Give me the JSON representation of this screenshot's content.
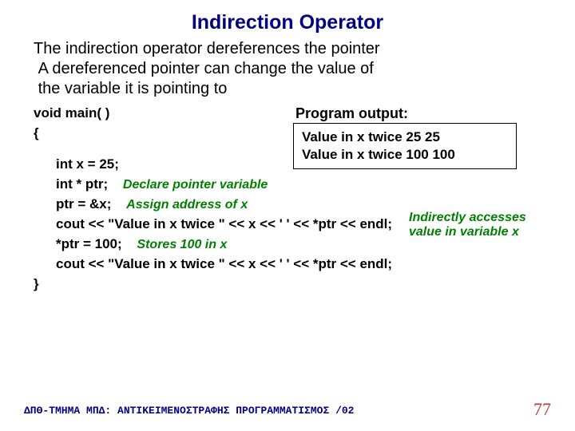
{
  "title": "Indirection Operator",
  "body": {
    "line1": "The indirection operator dereferences the pointer",
    "line2": "A dereferenced pointer can change the value of",
    "line3": "the variable it is pointing to"
  },
  "code": {
    "l1": "void main( )",
    "l2": "{",
    "l3": "int x = 25;",
    "l4": "int * ptr;",
    "l4_comment": "Declare pointer variable",
    "l5": "ptr = &x;",
    "l5_comment": "Assign address of x",
    "l6": "cout << \"Value in x twice \" << x << ' ' << *ptr << endl;",
    "l7": "*ptr = 100;",
    "l7_comment": "Stores 100 in x",
    "l8": "cout << \"Value in x twice \" << x << ' ' << *ptr << endl;",
    "l9": "}"
  },
  "output": {
    "label": "Program output:",
    "line1": "Value in x twice 25 25",
    "line2": "Value in x twice 100 100"
  },
  "side_note": {
    "line1": "Indirectly accesses",
    "line2": "value in variable x"
  },
  "footer": {
    "left": "ΔΠΘ-ΤΜΗΜΑ ΜΠΔ: ΑΝΤΙΚΕΙΜΕΝΟΣΤΡΑΦΗΣ ΠΡΟΓΡΑΜΜΑΤΙΣΜΟΣ /02",
    "right": "77"
  }
}
